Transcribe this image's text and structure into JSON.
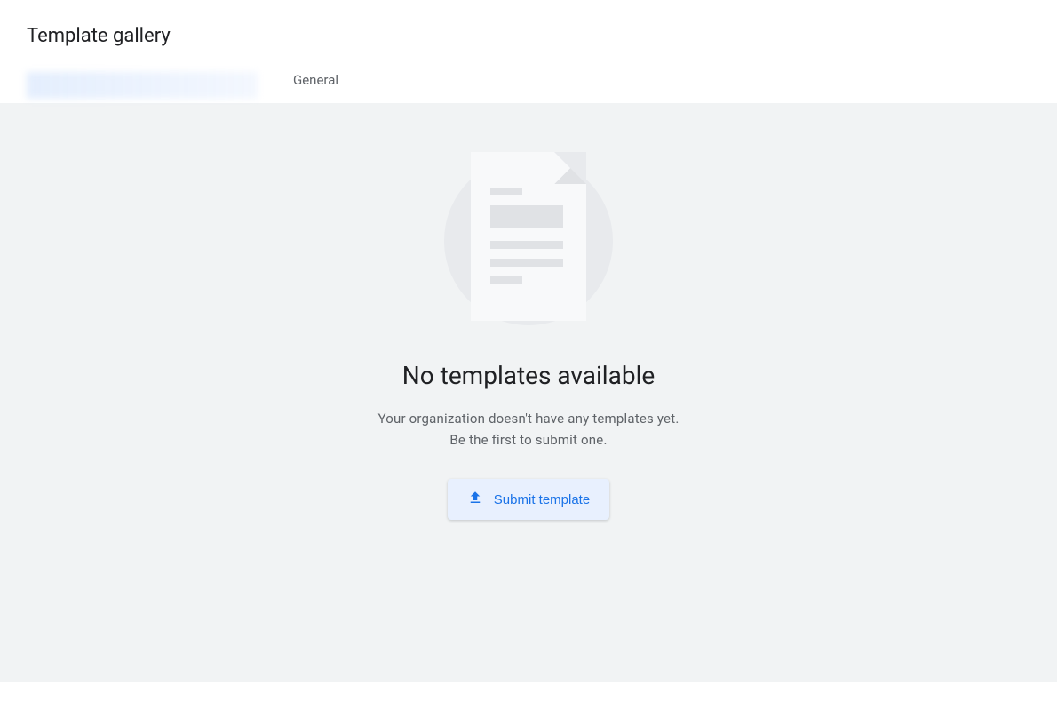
{
  "header": {
    "title": "Template gallery"
  },
  "tabs": {
    "org": "",
    "general": "General"
  },
  "empty": {
    "heading": "No templates available",
    "message": "Your organization doesn't have any templates yet. Be the first to submit one.",
    "button": "Submit template"
  }
}
